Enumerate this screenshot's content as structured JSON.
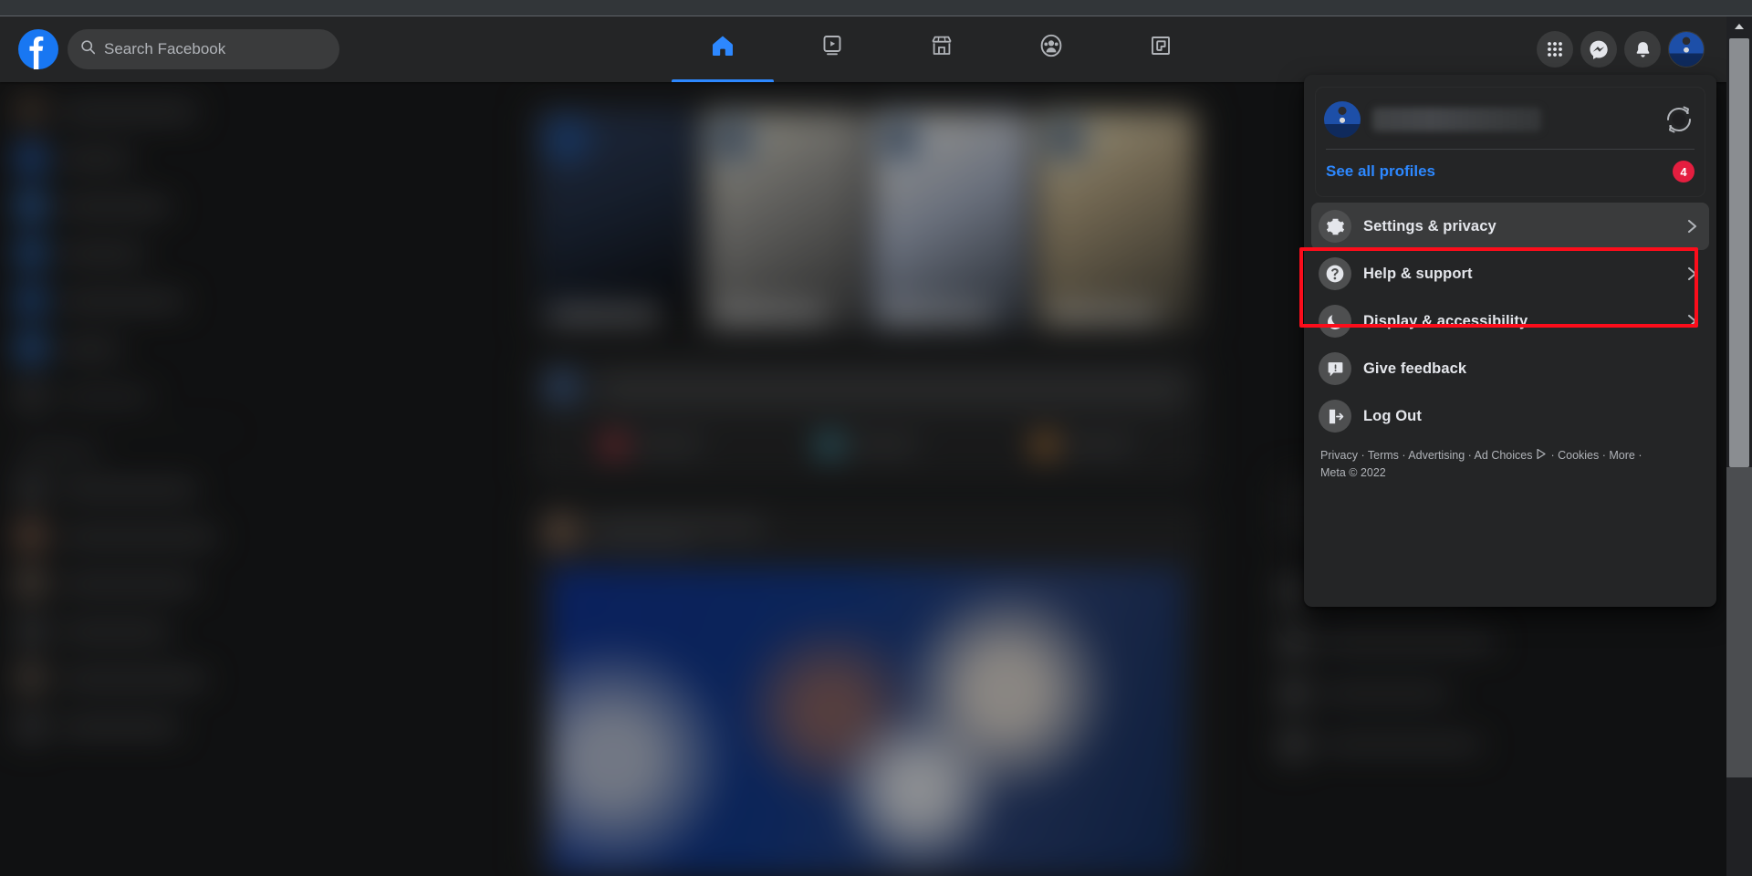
{
  "topbar": {
    "logo_alt": "facebook-logo",
    "search": {
      "placeholder": "Search Facebook",
      "value": "",
      "icon": "search-icon"
    },
    "nav": [
      {
        "id": "home",
        "icon": "home-icon",
        "label": "Home",
        "active": true
      },
      {
        "id": "watch",
        "icon": "video-icon",
        "label": "Watch",
        "active": false
      },
      {
        "id": "marketplace",
        "icon": "store-icon",
        "label": "Marketplace",
        "active": false
      },
      {
        "id": "groups",
        "icon": "groups-icon",
        "label": "Groups",
        "active": false
      },
      {
        "id": "gaming",
        "icon": "gaming-icon",
        "label": "Gaming",
        "active": false
      }
    ],
    "actions": [
      {
        "id": "menu",
        "icon": "grid-menu-icon",
        "label": "Menu"
      },
      {
        "id": "messenger",
        "icon": "messenger-icon",
        "label": "Messenger"
      },
      {
        "id": "notifications",
        "icon": "bell-icon",
        "label": "Notifications"
      },
      {
        "id": "account",
        "icon": "avatar-icon",
        "label": "Account"
      }
    ]
  },
  "dropdown": {
    "profile": {
      "name": "",
      "avatar": "profile-avatar",
      "switch_icon": "switch-profile-icon"
    },
    "see_all_profiles": "See all profiles",
    "see_all_badge": "4",
    "items": [
      {
        "id": "settings-privacy",
        "label": "Settings & privacy",
        "icon": "gear-icon",
        "chevron": true,
        "highlighted": true
      },
      {
        "id": "help-support",
        "label": "Help & support",
        "icon": "question-icon",
        "chevron": true,
        "highlighted": false
      },
      {
        "id": "display-accessibility",
        "label": "Display & accessibility",
        "icon": "moon-icon",
        "chevron": true,
        "highlighted": false
      },
      {
        "id": "give-feedback",
        "label": "Give feedback",
        "icon": "feedback-icon",
        "chevron": false,
        "highlighted": false
      },
      {
        "id": "log-out",
        "label": "Log Out",
        "icon": "logout-icon",
        "chevron": false,
        "highlighted": false
      }
    ],
    "footer_line1": "Privacy · Terms · Advertising · Ad Choices",
    "footer_adchoices_icon": "ad-choices-icon",
    "footer_line1_tail": "· Cookies ·",
    "footer_line2": "More · Meta © 2022"
  },
  "colors": {
    "accent_blue": "#2d88ff",
    "brand_blue": "#1877f2",
    "highlight_red": "#fc0d1b",
    "badge_red": "#e41e3f",
    "surface": "#242526",
    "page_bg": "#18191a",
    "text_primary": "#e4e6eb",
    "text_secondary": "#b0b3b8"
  },
  "scrollbar": {
    "orientation": "vertical",
    "position": "right"
  }
}
